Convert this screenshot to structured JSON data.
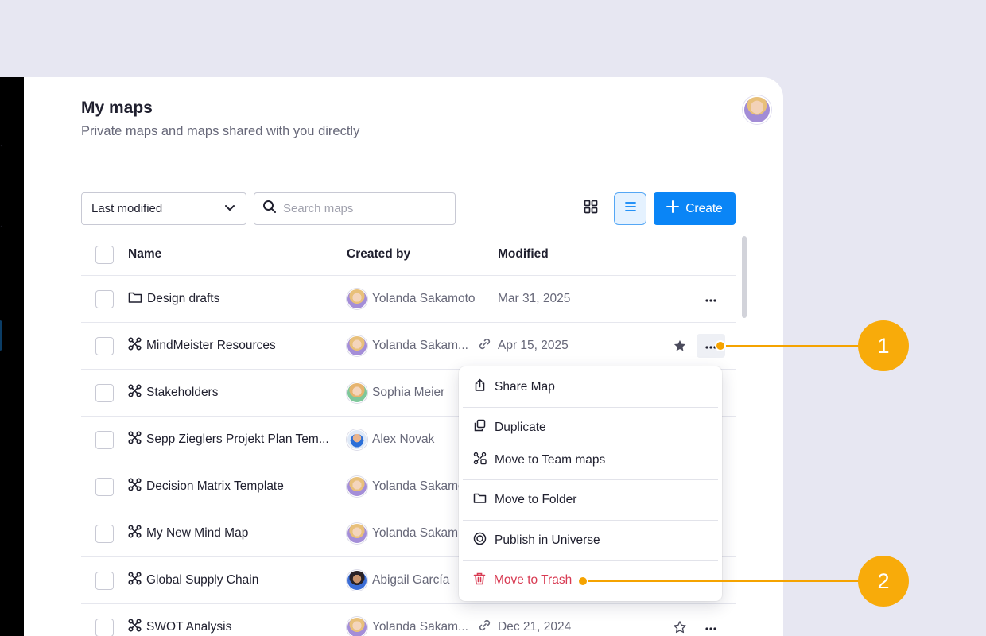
{
  "page": {
    "title": "My maps",
    "subtitle": "Private maps and maps shared with you directly"
  },
  "toolbar": {
    "sort_value": "Last modified",
    "search_placeholder": "Search maps",
    "create_label": "Create"
  },
  "table": {
    "columns": {
      "name": "Name",
      "created_by": "Created by",
      "modified": "Modified"
    },
    "rows": [
      {
        "name": "Design drafts",
        "type": "folder",
        "creator": "Yolanda Sakamoto",
        "avatar": "yolanda",
        "shared_link": false,
        "modified": "Mar 31, 2025",
        "star": "none"
      },
      {
        "name": "MindMeister Resources",
        "type": "map",
        "creator": "Yolanda Sakam...",
        "avatar": "yolanda",
        "shared_link": true,
        "modified": "Apr 15, 2025",
        "star": "filled"
      },
      {
        "name": "Stakeholders",
        "type": "map",
        "creator": "Sophia Meier",
        "avatar": "sophia",
        "shared_link": false,
        "modified": "",
        "star": "none"
      },
      {
        "name": "Sepp Zieglers Projekt Plan Tem...",
        "type": "map",
        "creator": "Alex Novak",
        "avatar": "alex",
        "shared_link": false,
        "modified": "",
        "star": "none"
      },
      {
        "name": "Decision Matrix Template",
        "type": "map",
        "creator": "Yolanda Sakamo",
        "avatar": "yolanda",
        "shared_link": false,
        "modified": "",
        "star": "none"
      },
      {
        "name": "My New Mind Map",
        "type": "map",
        "creator": "Yolanda Sakam...",
        "avatar": "yolanda",
        "shared_link": false,
        "modified": "",
        "star": "none"
      },
      {
        "name": "Global Supply Chain",
        "type": "map",
        "creator": "Abigail García",
        "avatar": "abigail",
        "shared_link": false,
        "modified": "",
        "star": "none"
      },
      {
        "name": "SWOT Analysis",
        "type": "map",
        "creator": "Yolanda Sakam...",
        "avatar": "yolanda",
        "shared_link": true,
        "modified": "Dec 21, 2024",
        "star": "outline"
      }
    ]
  },
  "context_menu": {
    "share": "Share Map",
    "duplicate": "Duplicate",
    "move_team": "Move to Team maps",
    "move_folder": "Move to Folder",
    "publish": "Publish in Universe",
    "trash": "Move to Trash"
  },
  "callouts": {
    "first": "1",
    "second": "2"
  },
  "colors": {
    "background": "#e7e7f2",
    "primary": "#0a85f6",
    "callout": "#f8ab0a",
    "danger": "#d83a52"
  }
}
